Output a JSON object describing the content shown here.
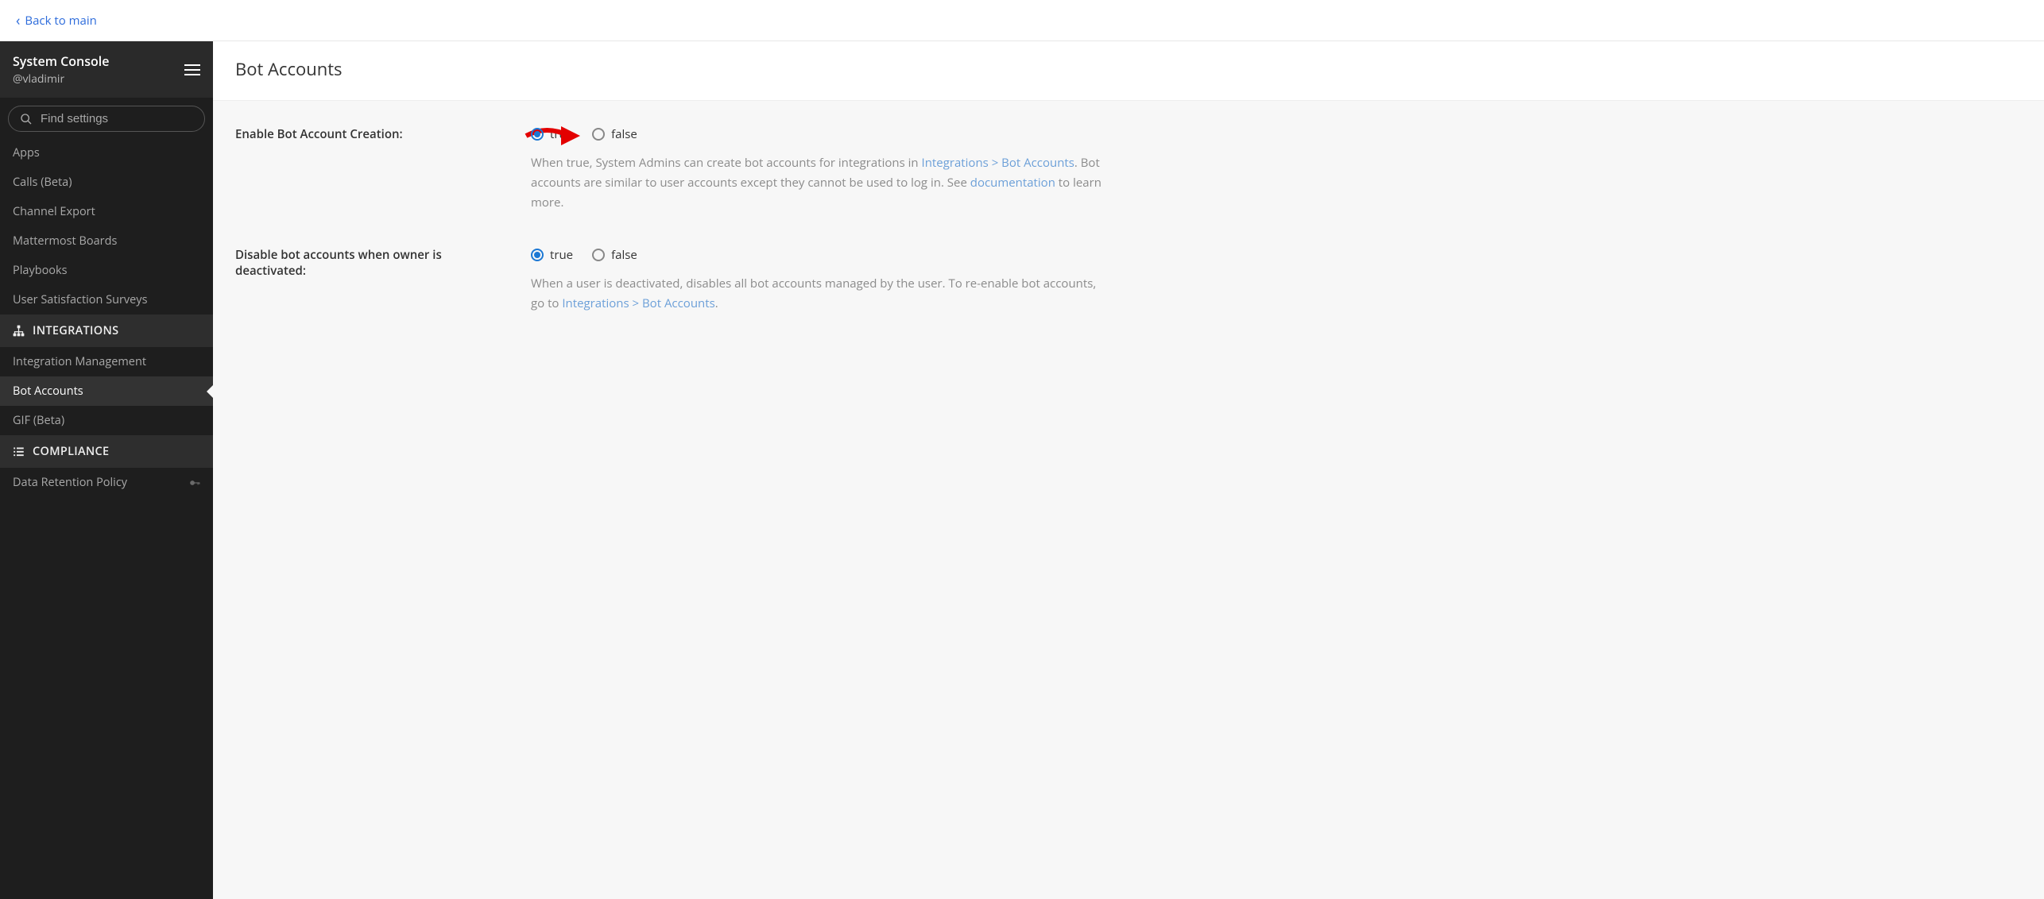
{
  "topbar": {
    "back_label": "Back to main"
  },
  "sidebar": {
    "title": "System Console",
    "username": "@vladimir",
    "search_placeholder": "Find settings",
    "plugin_items": [
      {
        "label": "Apps"
      },
      {
        "label": "Calls (Beta)"
      },
      {
        "label": "Channel Export"
      },
      {
        "label": "Mattermost Boards"
      },
      {
        "label": "Playbooks"
      },
      {
        "label": "User Satisfaction Surveys"
      }
    ],
    "section_integrations": "INTEGRATIONS",
    "integration_items": [
      {
        "label": "Integration Management",
        "active": false
      },
      {
        "label": "Bot Accounts",
        "active": true
      },
      {
        "label": "GIF (Beta)",
        "active": false
      }
    ],
    "section_compliance": "COMPLIANCE",
    "compliance_items": [
      {
        "label": "Data Retention Policy"
      }
    ]
  },
  "content": {
    "title": "Bot Accounts",
    "radio_true": "true",
    "radio_false": "false",
    "setting1": {
      "label": "Enable Bot Account Creation:",
      "selected": "true",
      "help_pre": "When true, System Admins can create bot accounts for integrations in ",
      "help_link1": "Integrations > Bot Accounts",
      "help_mid": ". Bot accounts are similar to user accounts except they cannot be used to log in. See ",
      "help_link2": "documentation",
      "help_post": " to learn more."
    },
    "setting2": {
      "label": "Disable bot accounts when owner is deactivated:",
      "selected": "true",
      "help_pre": "When a user is deactivated, disables all bot accounts managed by the user. To re-enable bot accounts, go to ",
      "help_link1": "Integrations > Bot Accounts",
      "help_post": "."
    }
  }
}
